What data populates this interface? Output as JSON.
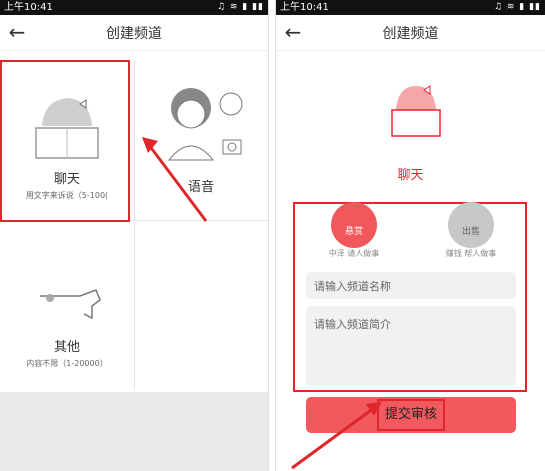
{
  "status": {
    "time": "上午10:41",
    "icons": "♫ ≋ ▮ ▮▮"
  },
  "appbar": {
    "back": "←",
    "title": "创建频道"
  },
  "left": {
    "chat": {
      "label": "聊天",
      "sub": "用文字来诉说（5-100("
    },
    "voice": {
      "label": "语音"
    },
    "other": {
      "label": "其他",
      "sub": "内容不限（1-20000）"
    }
  },
  "right": {
    "chat_title": "聊天",
    "options": [
      {
        "icon_text": "悬赏",
        "label": "中泽 请人做事"
      },
      {
        "icon_text": "出售",
        "label": "赚钱 帮人做事"
      }
    ],
    "name_placeholder": "请输入频道名称",
    "desc_placeholder": "请输入频道简介",
    "submit_label": "提交审核"
  },
  "colors": {
    "accent": "#e0262b",
    "button": "#f05a5e"
  }
}
